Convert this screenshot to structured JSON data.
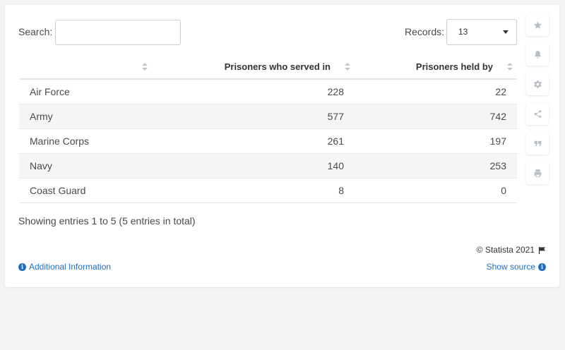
{
  "search": {
    "label": "Search:",
    "value": "",
    "placeholder": ""
  },
  "records": {
    "label": "Records:",
    "selected": "13"
  },
  "table": {
    "headers": [
      "",
      "Prisoners who served in",
      "Prisoners held by"
    ],
    "rows": [
      [
        "Air Force",
        "228",
        "22"
      ],
      [
        "Army",
        "577",
        "742"
      ],
      [
        "Marine Corps",
        "261",
        "197"
      ],
      [
        "Navy",
        "140",
        "253"
      ],
      [
        "Coast Guard",
        "8",
        "0"
      ]
    ]
  },
  "footer": {
    "entries_text": "Showing entries 1 to 5 (5 entries in total)",
    "copyright": "© Statista 2021",
    "additional_info": "Additional Information",
    "show_source": "Show source"
  },
  "sidebar": {
    "icons": [
      "star-icon",
      "bell-icon",
      "gear-icon",
      "share-icon",
      "quote-icon",
      "print-icon"
    ]
  },
  "colors": {
    "link": "#1e6cc5",
    "stripe": "#f4f5f7",
    "icon": "#b9bfc7"
  }
}
